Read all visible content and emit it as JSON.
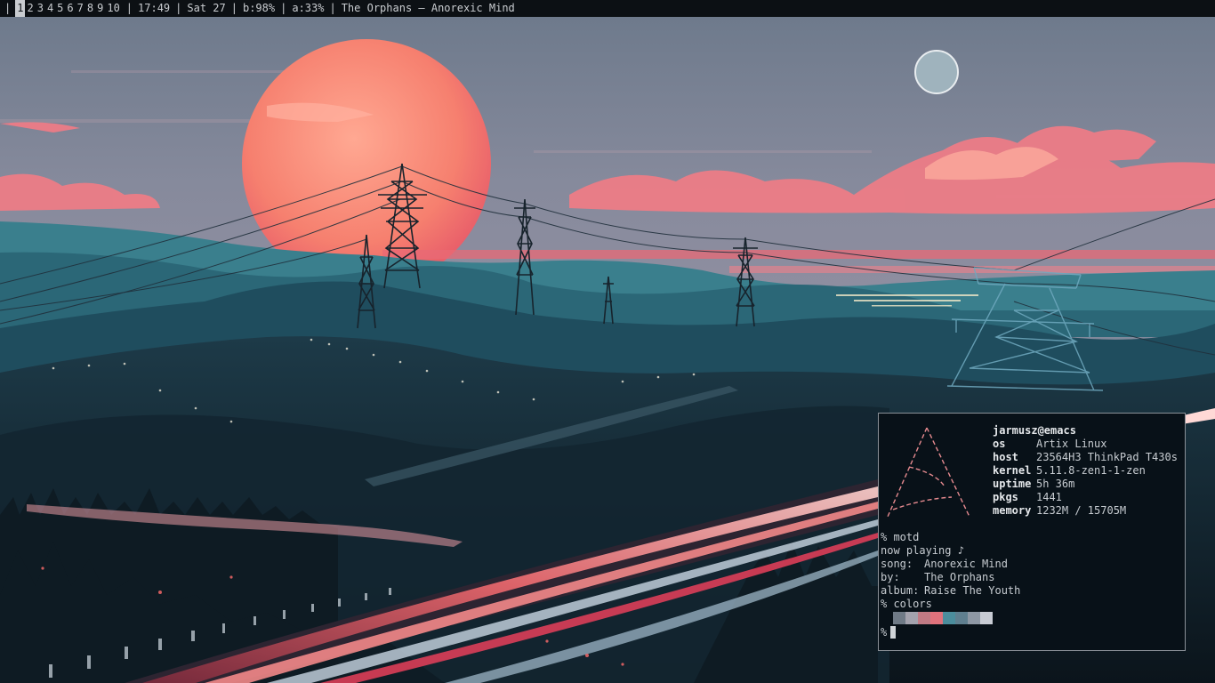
{
  "topbar": {
    "leading_sep": "|",
    "workspaces": [
      "1",
      "2",
      "3",
      "4",
      "5",
      "6",
      "7",
      "8",
      "9",
      "10"
    ],
    "active_workspace": "1",
    "sep": "|",
    "time": "17:49",
    "date": "Sat 27",
    "battery": "b:98%",
    "audio": "a:33%",
    "now_playing": "The Orphans – Anorexic Mind"
  },
  "terminal": {
    "fetch": {
      "user_host": "jarmusz@emacs",
      "rows": [
        {
          "key": "os",
          "value": "Artix Linux"
        },
        {
          "key": "host",
          "value": "23564H3 ThinkPad T430s"
        },
        {
          "key": "kernel",
          "value": "5.11.8-zen1-1-zen"
        },
        {
          "key": "uptime",
          "value": "5h 36m"
        },
        {
          "key": "pkgs",
          "value": "1441"
        },
        {
          "key": "memory",
          "value": "1232M / 15705M"
        }
      ]
    },
    "lines": {
      "cmd_motd": "% motd",
      "now_playing": "now playing ♪",
      "song_label": "song:",
      "song": "Anorexic Mind",
      "by_label": "by:",
      "by": "The Orphans",
      "album_label": "album:",
      "album": "Raise The Youth",
      "cmd_colors": "% colors",
      "prompt": "%"
    },
    "palette": [
      "#6f7a86",
      "#a3a2ad",
      "#c07a84",
      "#e0727c",
      "#4b8d9c",
      "#5f7f8f",
      "#8e98a4",
      "#c8ccd4"
    ],
    "colors": {
      "bg": "#081118",
      "border": "#8a9097",
      "fg": "#c7ccd1",
      "logo": "#e68a8f"
    }
  },
  "wallpaper": {
    "colors": {
      "sky_top": "#6e7b8e",
      "sky_mid": "#8f8e9e",
      "sun": "#f0766e",
      "clouds": "#f07f85",
      "mountains": "#2f6c7c",
      "foreground": "#14222c",
      "light_trail": "#e8566a"
    }
  }
}
